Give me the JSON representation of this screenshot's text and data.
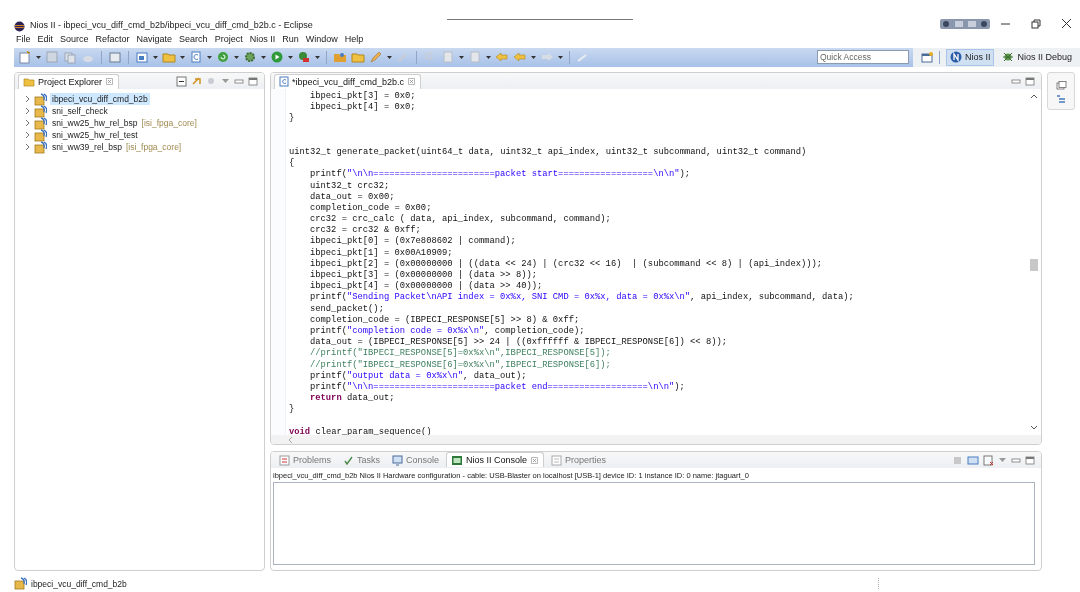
{
  "window": {
    "title": "Nios II - ibpeci_vcu_diff_cmd_b2b/ibpeci_vcu_diff_cmd_b2b.c - Eclipse"
  },
  "menu": [
    "File",
    "Edit",
    "Source",
    "Refactor",
    "Navigate",
    "Search",
    "Project",
    "Nios II",
    "Run",
    "Window",
    "Help"
  ],
  "toolbar": {
    "quick_access": {
      "placeholder": "Quick Access"
    },
    "perspectives": [
      {
        "label": "Nios II",
        "selected": true
      },
      {
        "label": "Nios II Debug",
        "selected": false
      }
    ]
  },
  "project_explorer": {
    "title": "Project Explorer",
    "items": [
      {
        "name": "ibpeci_vcu_diff_cmd_b2b",
        "selected": true,
        "expanded": false
      },
      {
        "name": "sni_self_check",
        "selected": false,
        "expanded": false
      },
      {
        "name": "sni_ww25_hw_rel_bsp",
        "qualifier": "[isi_fpga_core]",
        "selected": false,
        "expanded": false
      },
      {
        "name": "sni_ww25_hw_rel_test",
        "selected": false,
        "expanded": false
      },
      {
        "name": "sni_ww39_rel_bsp",
        "qualifier": "[isi_fpga_core]",
        "selected": false,
        "expanded": false
      }
    ]
  },
  "editor": {
    "tab": {
      "label": "*ibpeci_vcu_diff_cmd_b2b.c"
    },
    "lines": [
      {
        "kind": "code",
        "indented": true,
        "segments": [
          {
            "kind": "plain",
            "text": "ibpeci_pkt[3] = 0x0;"
          }
        ]
      },
      {
        "kind": "code",
        "indented": true,
        "segments": [
          {
            "kind": "plain",
            "text": "ibpeci_pkt[4] = 0x0;"
          }
        ]
      },
      {
        "kind": "code",
        "indented": false,
        "segments": [
          {
            "kind": "plain",
            "text": "}"
          }
        ]
      },
      {
        "kind": "blank"
      },
      {
        "kind": "blank"
      },
      {
        "kind": "code",
        "indented": false,
        "segments": [
          {
            "kind": "plain",
            "text": "uint32_t generate_packet(uint64_t data, uint32_t api_index, uint32_t subcommand, uint32_t command)"
          }
        ]
      },
      {
        "kind": "code",
        "indented": false,
        "segments": [
          {
            "kind": "plain",
            "text": "{"
          }
        ]
      },
      {
        "kind": "code",
        "indented": true,
        "segments": [
          {
            "kind": "plain",
            "text": "printf("
          },
          {
            "kind": "string",
            "text": "\"\\n\\n=======================packet start==================\\n\\n\""
          },
          {
            "kind": "plain",
            "text": ");"
          }
        ]
      },
      {
        "kind": "code",
        "indented": true,
        "segments": [
          {
            "kind": "plain",
            "text": "uint32_t crc32;"
          }
        ]
      },
      {
        "kind": "code",
        "indented": true,
        "segments": [
          {
            "kind": "plain",
            "text": "data_out = 0x00;"
          }
        ]
      },
      {
        "kind": "code",
        "indented": true,
        "segments": [
          {
            "kind": "plain",
            "text": "completion_code = 0x00;"
          }
        ]
      },
      {
        "kind": "code",
        "indented": true,
        "segments": [
          {
            "kind": "plain",
            "text": "crc32 = crc_calc ( data, api_index, subcommand, command);"
          }
        ]
      },
      {
        "kind": "code",
        "indented": true,
        "segments": [
          {
            "kind": "plain",
            "text": "crc32 = crc32 & 0xff;"
          }
        ]
      },
      {
        "kind": "code",
        "indented": true,
        "segments": [
          {
            "kind": "plain",
            "text": "ibpeci_pkt[0] = (0x7e808602 | command);"
          }
        ]
      },
      {
        "kind": "code",
        "indented": true,
        "segments": [
          {
            "kind": "plain",
            "text": "ibpeci_pkt[1] = 0x00A10909;"
          }
        ]
      },
      {
        "kind": "code",
        "indented": true,
        "segments": [
          {
            "kind": "plain",
            "text": "ibpeci_pkt[2] = (0x00000000 | ((data << 24) | (crc32 << 16)  | (subcommand << 8) | (api_index)));"
          }
        ]
      },
      {
        "kind": "code",
        "indented": true,
        "segments": [
          {
            "kind": "plain",
            "text": "ibpeci_pkt[3] = (0x00000000 | (data >> 8));"
          }
        ]
      },
      {
        "kind": "code",
        "indented": true,
        "segments": [
          {
            "kind": "plain",
            "text": "ibpeci_pkt[4] = (0x00000000 | (data >> 40));"
          }
        ]
      },
      {
        "kind": "code",
        "indented": true,
        "segments": [
          {
            "kind": "plain",
            "text": "printf("
          },
          {
            "kind": "string",
            "text": "\"Sending Packet\\nAPI index = 0x%x, SNI CMD = 0x%x, data = 0x%x\\n\""
          },
          {
            "kind": "plain",
            "text": ", api_index, subcommand, data);"
          }
        ]
      },
      {
        "kind": "code",
        "indented": true,
        "segments": [
          {
            "kind": "plain",
            "text": "send_packet();"
          }
        ]
      },
      {
        "kind": "code",
        "indented": true,
        "segments": [
          {
            "kind": "plain",
            "text": "completion_code = (IBPECI_RESPONSE[5] >> 8) & 0xff;"
          }
        ]
      },
      {
        "kind": "code",
        "indented": true,
        "segments": [
          {
            "kind": "plain",
            "text": "printf("
          },
          {
            "kind": "string",
            "text": "\"completion code = 0x%x\\n\""
          },
          {
            "kind": "plain",
            "text": ", completion_code);"
          }
        ]
      },
      {
        "kind": "code",
        "indented": true,
        "segments": [
          {
            "kind": "plain",
            "text": "data_out = (IBPECI_RESPONSE[5] >> 24 | ((0xffffff & IBPECI_RESPONSE[6]) << 8));"
          }
        ]
      },
      {
        "kind": "code",
        "indented": true,
        "segments": [
          {
            "kind": "comment",
            "text": "//printf(\"IBPECI_RESPONSE[5]=0x%x\\n\",IBPECI_RESPONSE[5]);"
          }
        ]
      },
      {
        "kind": "code",
        "indented": true,
        "segments": [
          {
            "kind": "comment",
            "text": "//printf(\"IBPECI_RESPONSE[6]=0x%x\\n\",IBPECI_RESPONSE[6]);"
          }
        ]
      },
      {
        "kind": "code",
        "indented": true,
        "segments": [
          {
            "kind": "plain",
            "text": "printf("
          },
          {
            "kind": "string",
            "text": "\"output data = 0x%x\\n\""
          },
          {
            "kind": "plain",
            "text": ", data_out);"
          }
        ]
      },
      {
        "kind": "code",
        "indented": true,
        "segments": [
          {
            "kind": "plain",
            "text": "printf("
          },
          {
            "kind": "string",
            "text": "\"\\n\\n=======================packet end===================\\n\\n\""
          },
          {
            "kind": "plain",
            "text": ");"
          }
        ]
      },
      {
        "kind": "code",
        "indented": true,
        "segments": [
          {
            "kind": "keyword",
            "text": "return"
          },
          {
            "kind": "plain",
            "text": " data_out;"
          }
        ]
      },
      {
        "kind": "code",
        "indented": false,
        "segments": [
          {
            "kind": "plain",
            "text": "}"
          }
        ]
      },
      {
        "kind": "blank"
      },
      {
        "kind": "code",
        "indented": false,
        "segments": [
          {
            "kind": "keyword",
            "text": "void"
          },
          {
            "kind": "plain",
            "text": " clear_param_sequence()"
          }
        ]
      }
    ]
  },
  "console": {
    "tabs": [
      {
        "label": "Problems",
        "selected": false
      },
      {
        "label": "Tasks",
        "selected": false
      },
      {
        "label": "Console",
        "selected": false
      },
      {
        "label": "Nios II Console",
        "selected": true
      },
      {
        "label": "Properties",
        "selected": false
      }
    ],
    "header": "ibpeci_vcu_diff_cmd_b2b Nios II Hardware configuration - cable: USB-Blaster on localhost [USB-1] device ID: 1 instance ID: 0 name: jtaguart_0"
  },
  "status_bar": {
    "text": "ibpeci_vcu_diff_cmd_b2b"
  }
}
